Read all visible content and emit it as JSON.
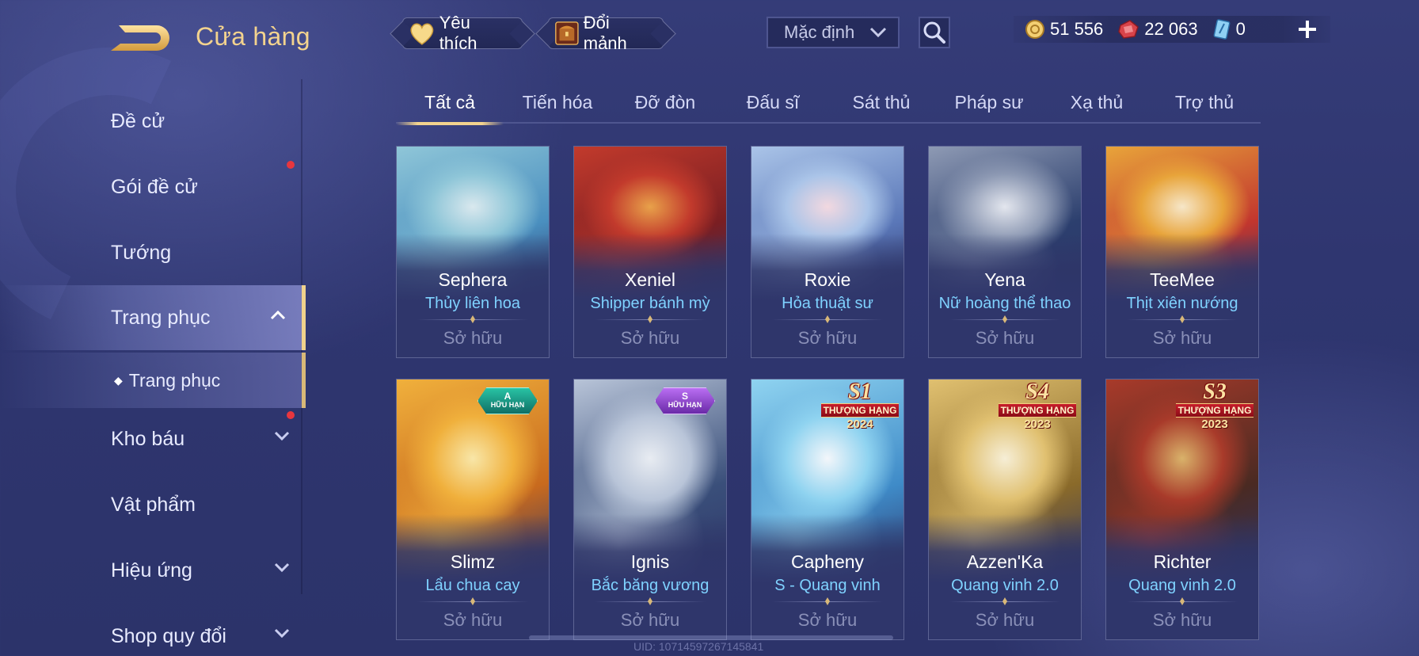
{
  "header": {
    "title": "Cửa hàng",
    "favorites_label": "Yêu thích",
    "exchange_label": "Đổi mảnh",
    "sort_selected": "Mặc định",
    "currencies": [
      {
        "icon": "gold-coin-icon",
        "amount": "51 556"
      },
      {
        "icon": "red-voucher-icon",
        "amount": "22 063"
      },
      {
        "icon": "blue-card-icon",
        "amount": "0"
      }
    ]
  },
  "sidebar": {
    "items": [
      {
        "label": "Đề cử"
      },
      {
        "label": "Gói đề cử"
      },
      {
        "label": "Tướng"
      },
      {
        "label": "Trang phục"
      },
      {
        "label": "Trang phục"
      },
      {
        "label": "Kho báu"
      },
      {
        "label": "Vật phẩm"
      },
      {
        "label": "Hiệu ứng"
      },
      {
        "label": "Shop quy đổi"
      }
    ]
  },
  "tabs": [
    "Tất cả",
    "Tiến hóa",
    "Đỡ đòn",
    "Đấu sĩ",
    "Sát thủ",
    "Pháp sư",
    "Xạ thủ",
    "Trợ thủ"
  ],
  "cards": [
    {
      "hero": "Sephera",
      "skin": "Thủy liên hoa",
      "status": "Sở hữu",
      "palette": [
        "#4a8fbf",
        "#8fc6d8",
        "#d9e8ee"
      ]
    },
    {
      "hero": "Xeniel",
      "skin": "Shipper bánh mỳ",
      "status": "Sở hữu",
      "palette": [
        "#7a1e22",
        "#c23a2c",
        "#e8a14a"
      ]
    },
    {
      "hero": "Roxie",
      "skin": "Hỏa thuật sư",
      "status": "Sở hữu",
      "palette": [
        "#5a77b8",
        "#aac4e8",
        "#f2d8e0"
      ]
    },
    {
      "hero": "Yena",
      "skin": "Nữ hoàng thể thao",
      "status": "Sở hữu",
      "palette": [
        "#2c3f6e",
        "#8e9ab4",
        "#e3e6ee"
      ]
    },
    {
      "hero": "TeeMee",
      "skin": "Thịt xiên nướng",
      "status": "Sở hữu",
      "palette": [
        "#c2362e",
        "#e8a43a",
        "#f6e6c8"
      ]
    },
    {
      "hero": "Slimz",
      "skin": "Lẩu chua cay",
      "status": "Sở hữu",
      "badge_rank": "A",
      "badge_label": "HỮU HẠN",
      "palette": [
        "#c86a1e",
        "#f0b03c",
        "#f8e6a8"
      ]
    },
    {
      "hero": "Ignis",
      "skin": "Bắc băng vương",
      "status": "Sở hữu",
      "badge_rank": "S",
      "badge_label": "HỮU HẠN",
      "palette": [
        "#3a4f7a",
        "#b8c4d8",
        "#e8ecf2"
      ]
    },
    {
      "hero": "Capheny",
      "skin": "S - Quang vinh",
      "status": "Sở hữu",
      "season": "S1",
      "season_label": "THƯỢNG HẠNG",
      "season_year": "2024",
      "palette": [
        "#3f8bc8",
        "#8fd3f0",
        "#f3f6fa"
      ]
    },
    {
      "hero": "Azzen'Ka",
      "skin": "Quang vinh 2.0",
      "status": "Sở hữu",
      "season": "S4",
      "season_label": "THƯỢNG HẠNG",
      "season_year": "2023",
      "palette": [
        "#8a6a2a",
        "#e0c070",
        "#f6eed6"
      ]
    },
    {
      "hero": "Richter",
      "skin": "Quang vinh 2.0",
      "status": "Sở hữu",
      "season": "S3",
      "season_label": "THƯỢNG HẠNG",
      "season_year": "2023",
      "palette": [
        "#4a2a22",
        "#a83a2a",
        "#d9b26a"
      ]
    }
  ],
  "footer": {
    "uid": "UID: 10714597267145841"
  },
  "colors": {
    "accent_gold": "#f3d38e",
    "skin_name": "#7fd2ff",
    "notification": "#e8363e"
  }
}
